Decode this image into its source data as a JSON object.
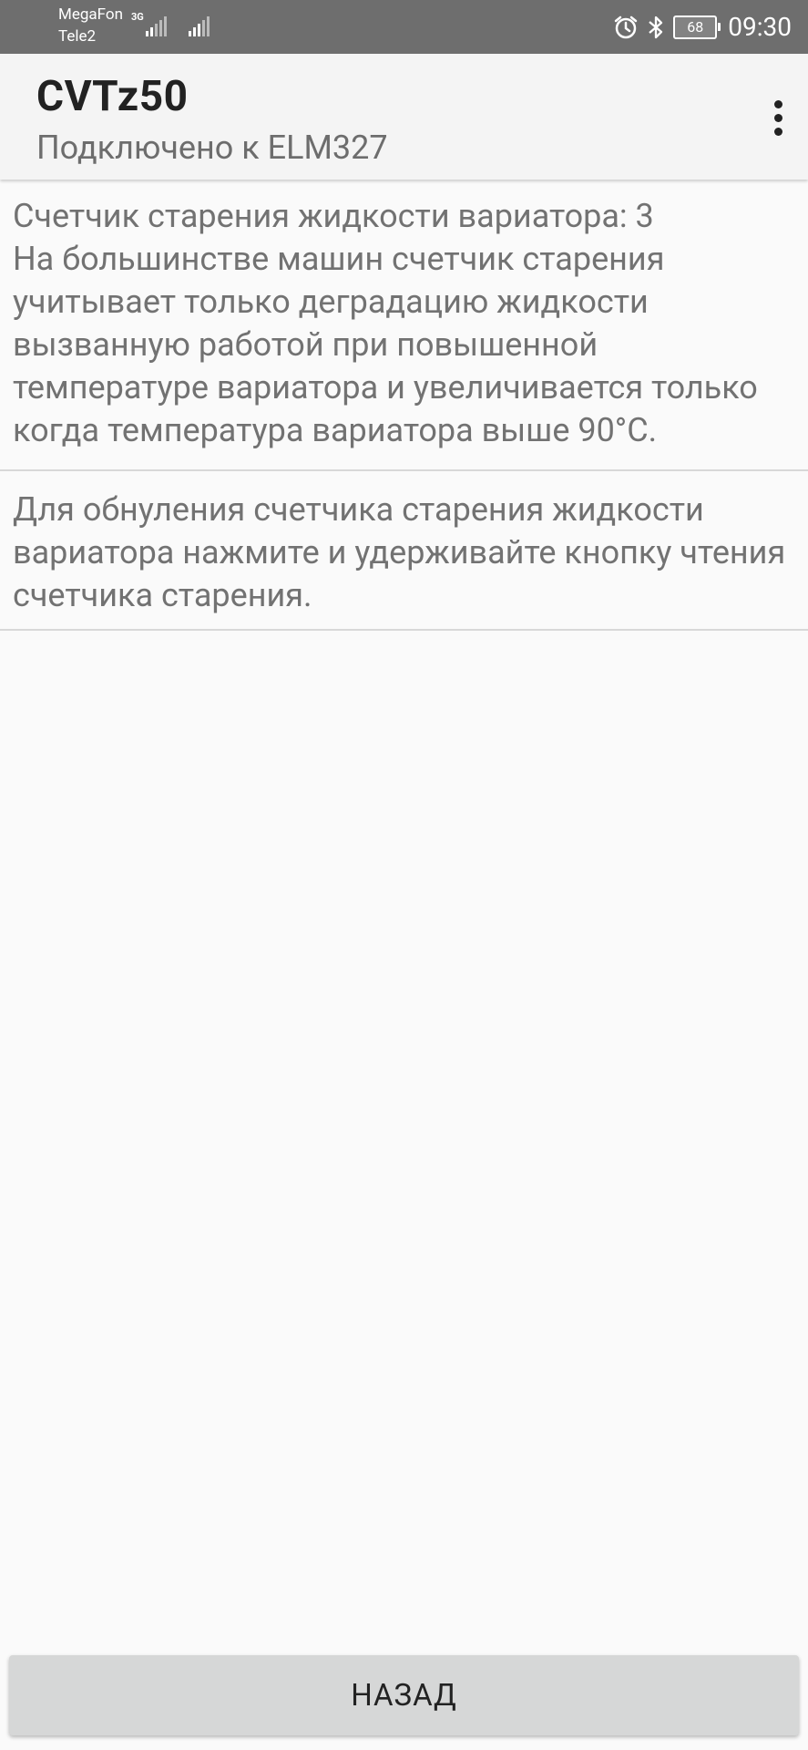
{
  "status_bar": {
    "carrier1": "MegaFon",
    "carrier2": "Tele2",
    "network_type": "3G",
    "battery": "68",
    "time": "09:30",
    "icons": [
      "signal-icon",
      "alarm-icon",
      "bluetooth-icon",
      "battery-icon"
    ]
  },
  "app_bar": {
    "title": "CVTz50",
    "subtitle": "Подключено к ELM327",
    "menu_icon": "more-vert-icon"
  },
  "content": {
    "counter_line": "Счетчик старения жидкости вариатора: 3",
    "description": "На большинстве машин счетчик старения учитывает только деградацию жидкости вызванную работой при повышенной температуре вариатора и увеличивается только когда температура вариатора выше 90°С.",
    "reset_hint": "Для обнуления счетчика старения жидкости вариатора нажмите и удерживайте кнопку чтения счетчика старения."
  },
  "footer": {
    "back_label": "НАЗАД"
  },
  "colors": {
    "status_bar_bg": "#6e6e6e",
    "app_bar_bg": "#f4f4f4",
    "page_bg": "#fafafa",
    "button_bg": "#d6d7d7"
  }
}
